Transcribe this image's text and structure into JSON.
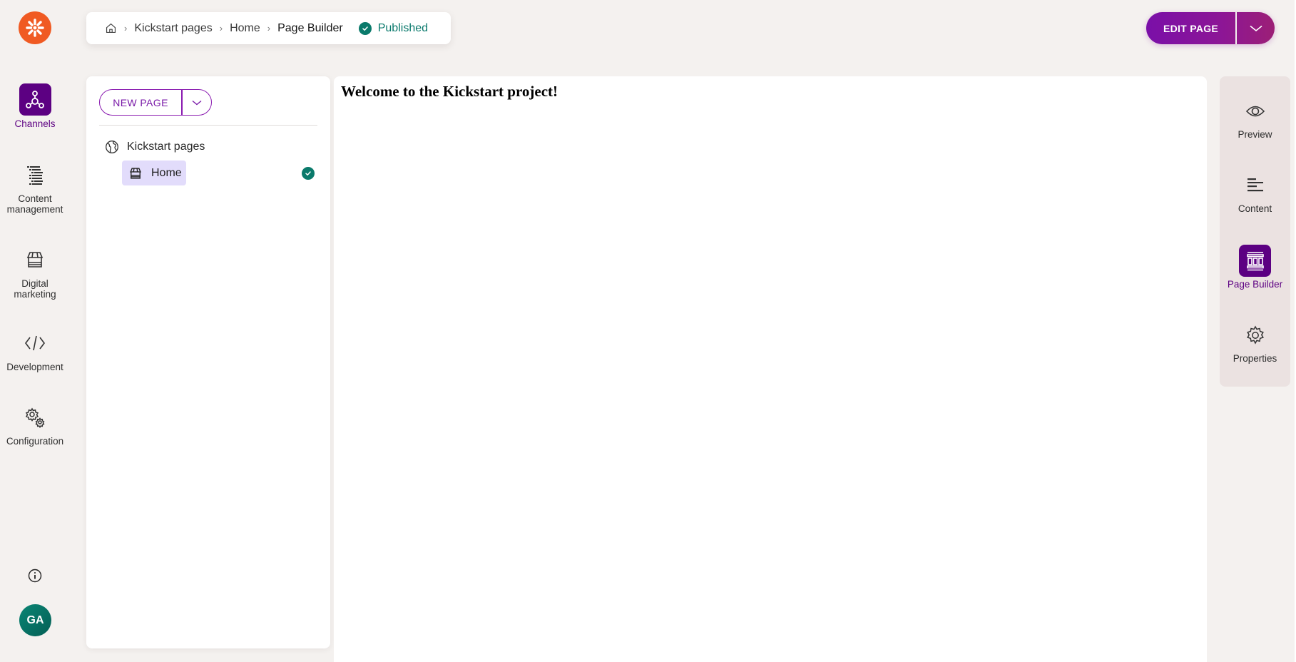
{
  "app": {
    "logo": "kentico-logo-icon"
  },
  "breadcrumb": {
    "home_icon": "home-icon",
    "items": [
      "Kickstart pages",
      "Home",
      "Page Builder"
    ],
    "status": "Published",
    "status_icon": "check-circle-icon"
  },
  "toolbar": {
    "edit_page_label": "EDIT PAGE",
    "edit_page_menu_icon": "chevron-down-icon"
  },
  "left_nav": {
    "items": [
      {
        "label": "Channels",
        "icon": "channels-icon",
        "active": true
      },
      {
        "label": "Content management",
        "icon": "content-tree-icon",
        "active": false
      },
      {
        "label": "Digital marketing",
        "icon": "store-icon",
        "active": false
      },
      {
        "label": "Development",
        "icon": "code-icon",
        "active": false
      },
      {
        "label": "Configuration",
        "icon": "cogwheels-icon",
        "active": false
      }
    ],
    "info_icon": "info-icon",
    "avatar_initials": "GA"
  },
  "tree_panel": {
    "new_page_label": "NEW PAGE",
    "root": {
      "label": "Kickstart pages",
      "icon": "globe-icon"
    },
    "children": [
      {
        "label": "Home",
        "icon": "store-icon",
        "selected": true,
        "status": "published"
      }
    ]
  },
  "content": {
    "heading": "Welcome to the Kickstart project!"
  },
  "right_rail": {
    "items": [
      {
        "label": "Preview",
        "icon": "eye-icon",
        "active": false
      },
      {
        "label": "Content",
        "icon": "text-lines-icon",
        "active": false
      },
      {
        "label": "Page Builder",
        "icon": "layout-columns-icon",
        "active": true
      },
      {
        "label": "Properties",
        "icon": "gear-icon",
        "active": false
      }
    ]
  },
  "colors": {
    "brand_orange": "#f05a22",
    "accent_purple": "#5c0082",
    "published_green": "#0a7a6b"
  }
}
